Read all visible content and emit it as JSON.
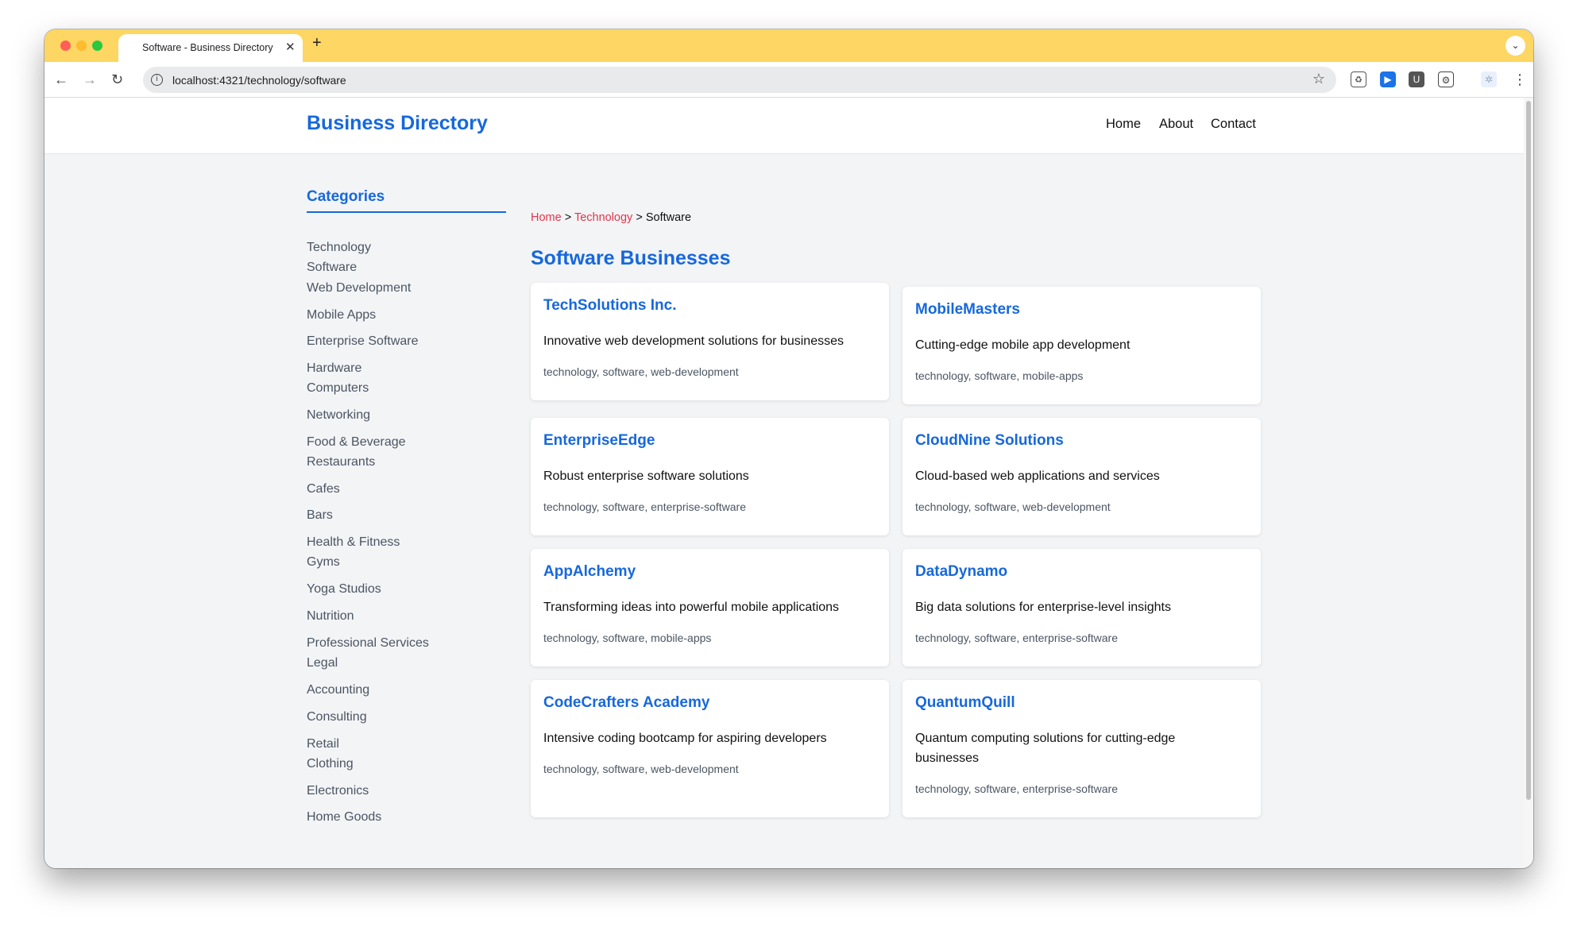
{
  "browser": {
    "tab_title": "Software - Business Directory",
    "tab_close": "✕",
    "new_tab": "+",
    "tab_menu": "⌄",
    "url": "localhost:4321/technology/software",
    "back": "←",
    "forward": "→",
    "reload": "↻",
    "star": "☆",
    "menu": "⋮"
  },
  "header": {
    "brand": "Business Directory",
    "nav": [
      "Home",
      "About",
      "Contact"
    ]
  },
  "sidebar": {
    "title": "Categories",
    "items": [
      "Technology",
      "Software",
      "Web Development",
      "Mobile Apps",
      "Enterprise Software",
      "Hardware",
      "Computers",
      "Networking",
      "Food & Beverage",
      "Restaurants",
      "Cafes",
      "Bars",
      "Health & Fitness",
      "Gyms",
      "Yoga Studios",
      "Nutrition",
      "Professional Services",
      "Legal",
      "Accounting",
      "Consulting",
      "Retail",
      "Clothing",
      "Electronics",
      "Home Goods"
    ]
  },
  "breadcrumb": {
    "home": "Home",
    "sep1": " > ",
    "technology": "Technology",
    "sep2": " > ",
    "current": "Software"
  },
  "main": {
    "title": "Software Businesses",
    "cards": [
      {
        "title": "TechSolutions Inc.",
        "desc": "Innovative web development solutions for businesses",
        "tags": "technology, software, web-development"
      },
      {
        "title": "MobileMasters",
        "desc": "Cutting-edge mobile app development",
        "tags": "technology, software, mobile-apps"
      },
      {
        "title": "EnterpriseEdge",
        "desc": "Robust enterprise software solutions",
        "tags": "technology, software, enterprise-software"
      },
      {
        "title": "CloudNine Solutions",
        "desc": "Cloud-based web applications and services",
        "tags": "technology, software, web-development"
      },
      {
        "title": "AppAlchemy",
        "desc": "Transforming ideas into powerful mobile applications",
        "tags": "technology, software, mobile-apps"
      },
      {
        "title": "DataDynamo",
        "desc": "Big data solutions for enterprise-level insights",
        "tags": "technology, software, enterprise-software"
      },
      {
        "title": "CodeCrafters Academy",
        "desc": "Intensive coding bootcamp for aspiring developers",
        "tags": "technology, software, web-development"
      },
      {
        "title": "QuantumQuill",
        "desc": "Quantum computing solutions for cutting-edge businesses",
        "tags": "technology, software, enterprise-software"
      }
    ]
  }
}
